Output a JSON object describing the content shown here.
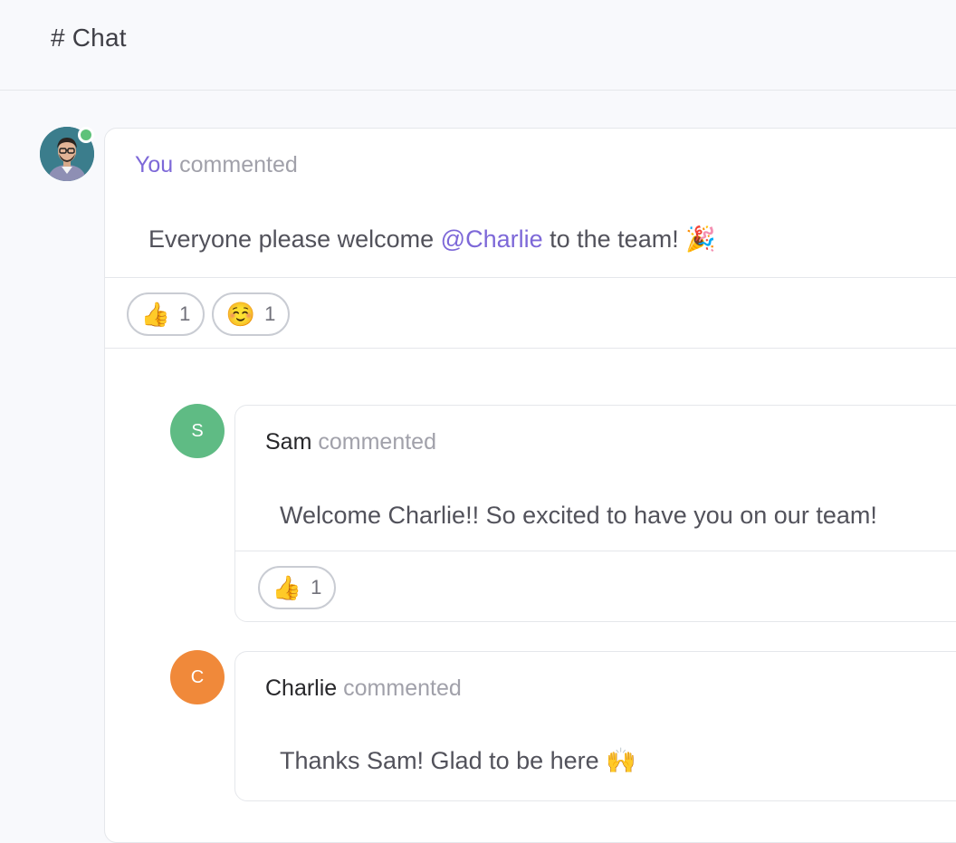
{
  "header": {
    "title": "# Chat"
  },
  "thread": {
    "author": "You",
    "verb": "commented",
    "message_prefix": "Everyone please welcome ",
    "mention": "@Charlie",
    "message_suffix": "  to the team! 🎉",
    "reactions": [
      {
        "emoji": "👍",
        "count": "1"
      },
      {
        "emoji": "☺️",
        "count": "1"
      }
    ]
  },
  "replies": [
    {
      "avatar_letter": "S",
      "avatar_color": "#5fbb84",
      "author": "Sam",
      "verb": "commented",
      "message": "Welcome Charlie!! So excited to have you on our team!",
      "reactions": [
        {
          "emoji": "👍",
          "count": "1"
        }
      ]
    },
    {
      "avatar_letter": "C",
      "avatar_color": "#f0893a",
      "author": "Charlie",
      "verb": "commented",
      "message": "Thanks Sam! Glad to be here 🙌"
    }
  ],
  "colors": {
    "accent": "#7d68d8",
    "online": "#5ec27a",
    "background": "#f8f9fc"
  }
}
